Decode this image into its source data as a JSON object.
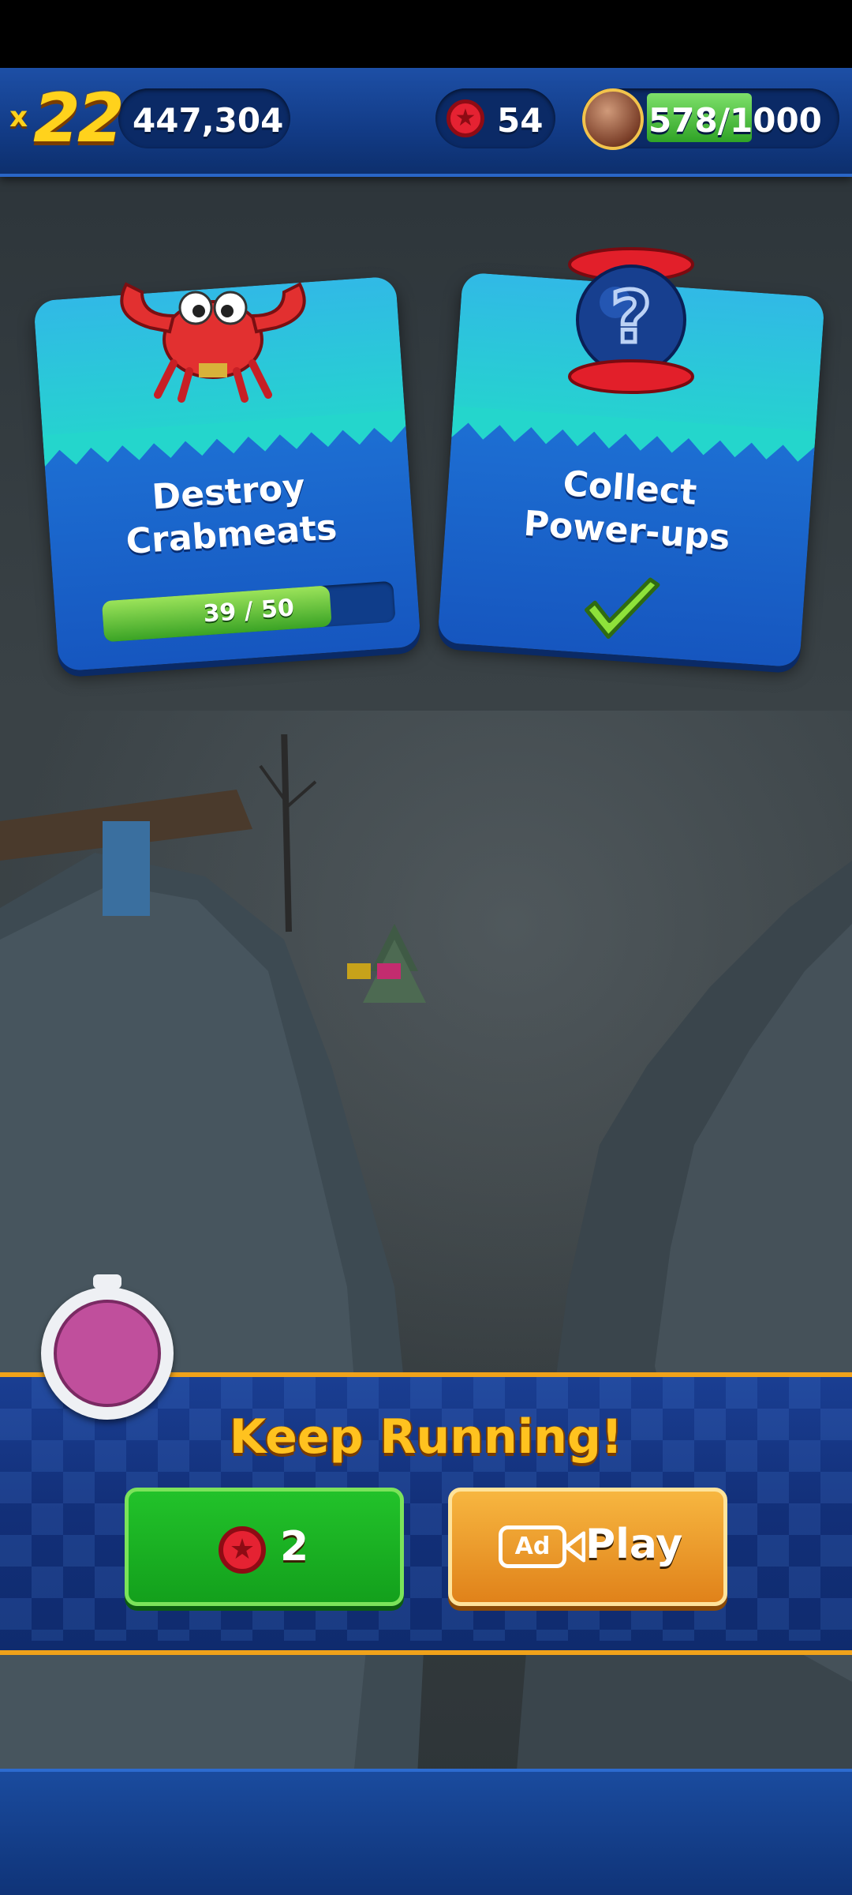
{
  "hud": {
    "multiplier_prefix": "x",
    "multiplier": "22",
    "score": "447,304",
    "red_rings": "54",
    "energy": "578/1000",
    "energy_fraction": 0.578
  },
  "missions": [
    {
      "title_line1": "Destroy",
      "title_line2": "Crabmeats",
      "progress_text": "39 / 50",
      "progress": 0.78,
      "icon": "crabmeat-icon"
    },
    {
      "title_line1": "Collect",
      "title_line2": "Power-ups",
      "completed": true,
      "icon": "mystery-powerup-icon"
    }
  ],
  "continue_panel": {
    "title": "Keep Running!",
    "ring_cost": "2",
    "ad_badge": "Ad",
    "ad_label": "Play",
    "timer_color": "#c04f9c"
  },
  "colors": {
    "accent_gold": "#ffc21f",
    "panel_blue": "#122f78",
    "green_button": "#13a01c",
    "orange_button": "#e0821a"
  }
}
